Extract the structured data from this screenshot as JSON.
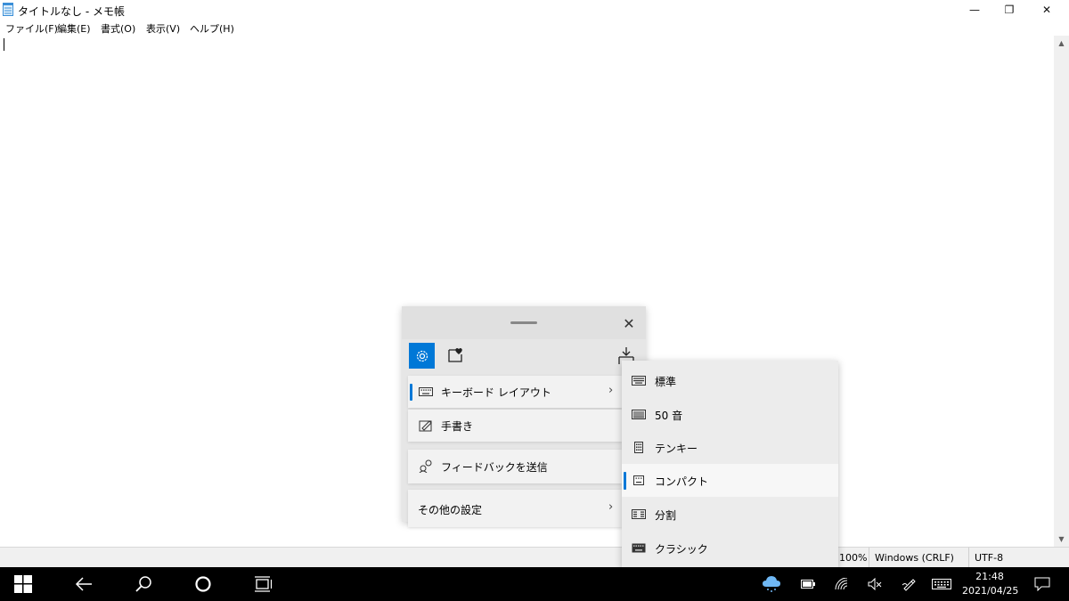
{
  "window": {
    "title": "タイトルなし - メモ帳",
    "controls": {
      "minimize": "—",
      "maximize": "❐",
      "close": "✕"
    }
  },
  "menubar": {
    "items": [
      {
        "label": "ファイル(F)"
      },
      {
        "label": "編集(E)"
      },
      {
        "label": "書式(O)"
      },
      {
        "label": "表示(V)"
      },
      {
        "label": "ヘルプ(H)"
      }
    ]
  },
  "statusbar": {
    "zoom": "100%",
    "line_ending": "Windows (CRLF)",
    "encoding": "UTF-8"
  },
  "keyboard_panel": {
    "close_glyph": "✕",
    "tools": {
      "settings_icon": "gear-icon",
      "emoji_icon": "emoji-heart-icon",
      "dock_icon": "dock-icon"
    },
    "items": [
      {
        "label": "キーボード レイアウト",
        "chevron": "›",
        "selected": true
      },
      {
        "label": "手書き"
      },
      {
        "label": "フィードバックを送信"
      },
      {
        "label": "その他の設定",
        "chevron": "›"
      }
    ]
  },
  "layout_submenu": {
    "items": [
      {
        "label": "標準"
      },
      {
        "label": "50 音"
      },
      {
        "label": "テンキー"
      },
      {
        "label": "コンパクト",
        "selected": true
      },
      {
        "label": "分割"
      },
      {
        "label": "クラシック"
      }
    ]
  },
  "taskbar": {
    "clock_time": "21:48",
    "clock_date": "2021/04/25"
  },
  "colors": {
    "accent": "#0078d7",
    "taskbar": "#000000",
    "panel": "#e6e6e6"
  }
}
